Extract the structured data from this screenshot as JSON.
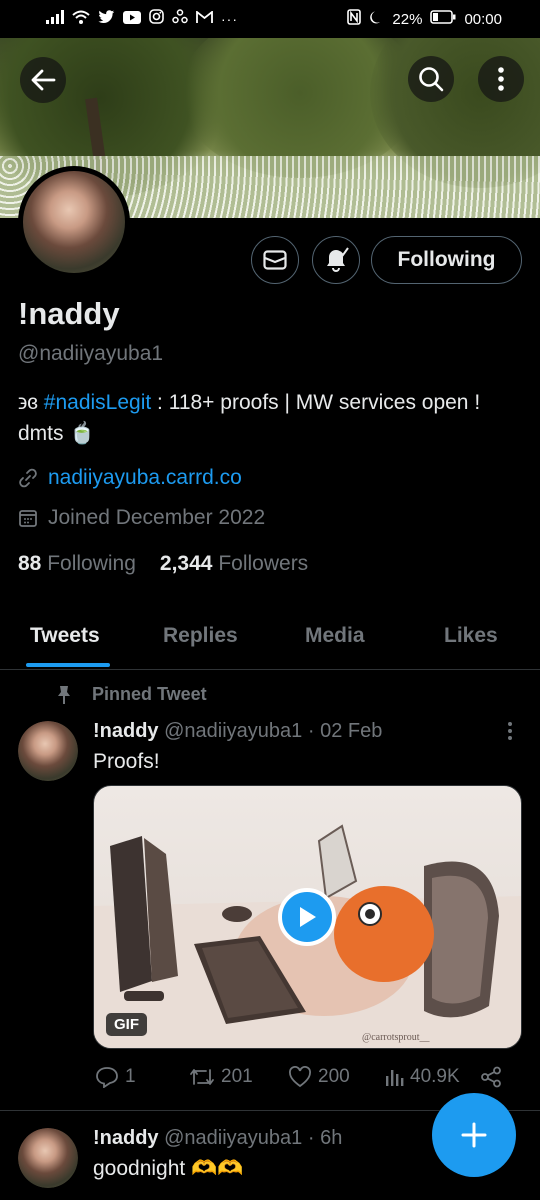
{
  "status_bar": {
    "left_icons": [
      "signal-icon",
      "wifi-icon",
      "twitter-icon",
      "youtube-icon",
      "instagram-icon",
      "app-icon",
      "gmail-icon",
      "more-dots-icon"
    ],
    "battery": "22%",
    "time": "00:00"
  },
  "profile": {
    "name": "!naddy",
    "handle": "@nadiiyayuba1",
    "bio_prefix": "϶ɞ",
    "bio_hashtag": "#nadisLegit",
    "bio_rest": " : 118+ proofs | MW services open ! dmts 🍵",
    "link": "nadiiyayuba.carrd.co",
    "joined": "Joined December 2022",
    "following_count": "88",
    "following_label": "Following",
    "followers_count": "2,344",
    "followers_label": "Followers",
    "follow_button": "Following"
  },
  "tabs": [
    "Tweets",
    "Replies",
    "Media",
    "Likes"
  ],
  "pinned_label": "Pinned Tweet",
  "tweets": [
    {
      "name": "!naddy",
      "handle": "@nadiiyayuba1",
      "sep": " · ",
      "date": "02 Feb",
      "text": "Proofs!",
      "media_badge": "GIF",
      "media_watermark": "@carrotsprout__",
      "replies": "1",
      "retweets": "201",
      "likes": "200",
      "views": "40.9K"
    },
    {
      "name": "!naddy",
      "handle": "@nadiiyayuba1",
      "sep": " · ",
      "date": "6h",
      "text": "goodnight 🫶🫶"
    }
  ],
  "colors": {
    "accent": "#1d9bf0",
    "muted": "#71767b",
    "text": "#e7e9ea",
    "border": "#2f3336"
  }
}
